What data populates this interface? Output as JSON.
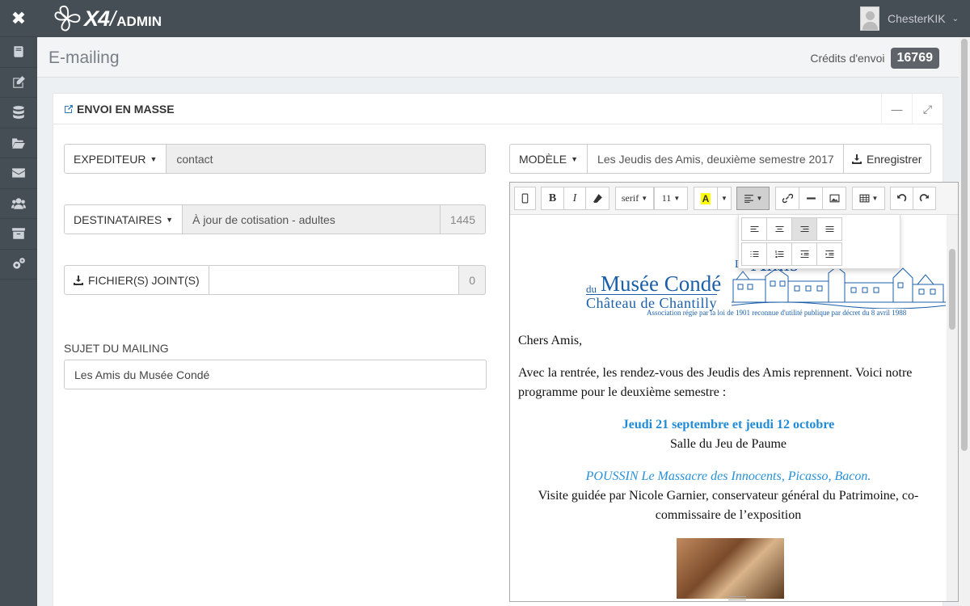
{
  "app": {
    "close_glyph": "✖",
    "logo_x4": "X4",
    "logo_slash": "/",
    "logo_admin": "ADMIN",
    "user_name": "ChesterKIK"
  },
  "sidebar": {
    "items": [
      {
        "icon": "book-icon"
      },
      {
        "icon": "edit-icon"
      },
      {
        "icon": "database-icon"
      },
      {
        "icon": "folder-open-icon"
      },
      {
        "icon": "envelope-icon"
      },
      {
        "icon": "users-icon"
      },
      {
        "icon": "archive-icon"
      },
      {
        "icon": "cogs-icon"
      }
    ]
  },
  "header": {
    "title": "E-mailing",
    "credits_label": "Crédits d'envoi",
    "credits_value": "16769"
  },
  "panel": {
    "title": "ENVOI EN MASSE",
    "minimize_glyph": "—",
    "expand_glyph": "⤢"
  },
  "form": {
    "expediteur_label": "EXPEDITEUR",
    "expediteur_value": "contact",
    "destinataires_label": "DESTINATAIRES",
    "destinataires_value": "À jour de cotisation - adultes",
    "destinataires_count": "1445",
    "fichiers_label": "FICHIER(S) JOINT(S)",
    "fichiers_value": "",
    "fichiers_count": "0",
    "sujet_label": "SUJET DU MAILING",
    "sujet_value": "Les Amis du Musée Condé",
    "modele_label": "MODÈLE",
    "modele_value": "Les Jeudis des Amis, deuxième semestre 2017",
    "save_label": "Enregistrer"
  },
  "toolbar": {
    "font_name": "serif",
    "font_size": "11",
    "bold": "B",
    "italic": "I",
    "color_letter": "A"
  },
  "email": {
    "logo_les": "Les",
    "logo_amis": "Amis",
    "logo_du": "du",
    "logo_musee": "Musée Condé",
    "logo_chateau": "Château de Chantilly",
    "logo_assoc": "Association régie par la loi de 1901 reconnue d'utilité publique par décret du 8 avril 1988",
    "greeting": "Chers Amis,",
    "intro": "Avec la rentrée, les rendez-vous des Jeudis des Amis reprennent. Voici notre programme pour le deuxième semestre :",
    "dates": "Jeudi 21 septembre et jeudi 12 octobre",
    "salle": "Salle du Jeu de Paume",
    "expo": "POUSSIN Le Massacre des Innocents, Picasso, Bacon.",
    "visite": "Visite guidée par Nicole Garnier, conservateur général du Patrimoine, co-commissaire de l’exposition"
  },
  "colors": {
    "sidebar_bg": "#464e55",
    "accent_blue": "#1f8ad6",
    "logo_blue": "#1b5fa8"
  }
}
